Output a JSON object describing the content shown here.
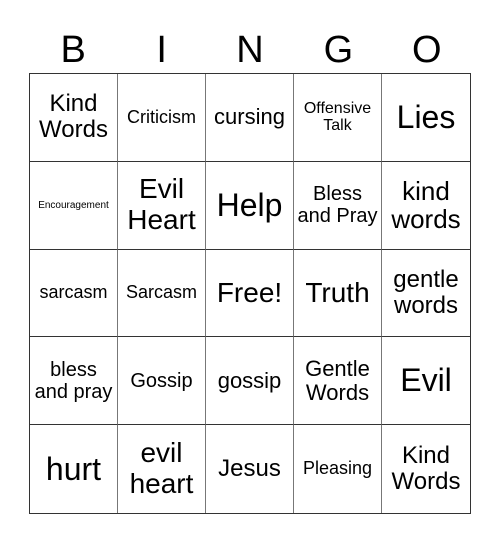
{
  "header": {
    "letters": [
      "B",
      "I",
      "N",
      "G",
      "O"
    ]
  },
  "cells": [
    [
      "Kind Words",
      "Criticism",
      "cursing",
      "Offensive Talk",
      "Lies"
    ],
    [
      "Encouragement",
      "Evil Heart",
      "Help",
      "Bless and Pray",
      "kind words"
    ],
    [
      "sarcasm",
      "Sarcasm",
      "Free!",
      "Truth",
      "gentle words"
    ],
    [
      "bless and pray",
      "Gossip",
      "gossip",
      "Gentle Words",
      "Evil"
    ],
    [
      "hurt",
      "evil heart",
      "Jesus",
      "Pleasing",
      "Kind Words"
    ]
  ],
  "colors": {
    "grid_line": "#333333",
    "grid_line_inner": "#777777",
    "text": "#000000",
    "background": "#ffffff"
  }
}
